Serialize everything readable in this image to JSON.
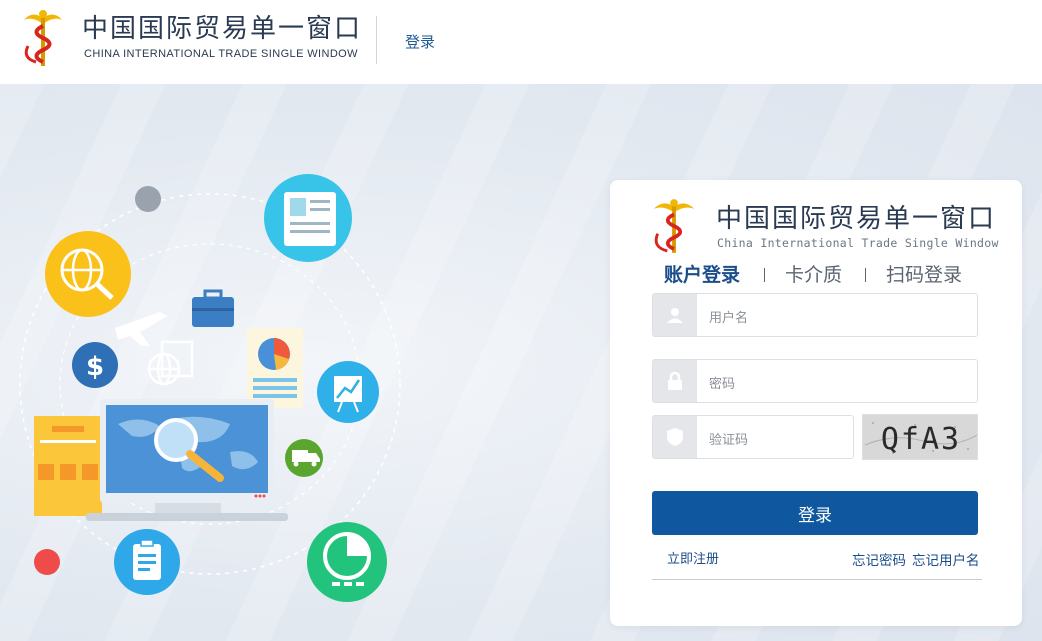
{
  "header": {
    "brand_cn": "中国国际贸易单一窗口",
    "brand_en": "CHINA INTERNATIONAL TRADE SINGLE WINDOW",
    "login_link": "登录"
  },
  "card": {
    "title": "中国国际贸易单一窗口",
    "subtitle": "China International Trade Single Window",
    "tabs": [
      {
        "label": "账户登录",
        "active": true
      },
      {
        "label": "卡介质",
        "active": false
      },
      {
        "label": "扫码登录",
        "active": false
      }
    ],
    "username_placeholder": "用户名",
    "password_placeholder": "密码",
    "captcha_placeholder": "验证码",
    "captcha_text": "QfA3",
    "submit_label": "登录",
    "register_label": "立即注册",
    "forgot_password": "忘记密码",
    "forgot_username": "忘记用户名"
  },
  "colors": {
    "primary": "#0f58a0",
    "brand_dark": "#2a3a52",
    "link": "#1b4d8a",
    "background": "#e7ecf3"
  }
}
